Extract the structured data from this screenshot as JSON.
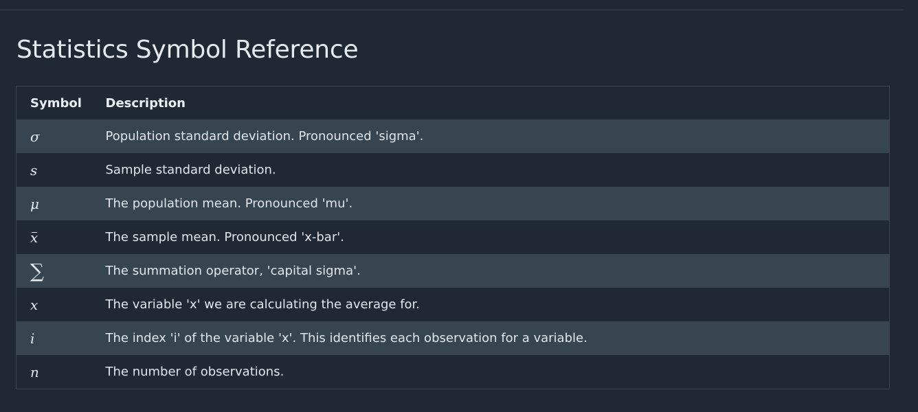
{
  "page": {
    "title": "Statistics Symbol Reference"
  },
  "table": {
    "headers": {
      "symbol": "Symbol",
      "description": "Description"
    },
    "rows": [
      {
        "symbol": "σ",
        "description": "Population standard deviation. Pronounced 'sigma'."
      },
      {
        "symbol": "s",
        "description": "Sample standard deviation."
      },
      {
        "symbol": "μ",
        "description": "The population mean. Pronounced 'mu'."
      },
      {
        "symbol": "x",
        "description": "The sample mean. Pronounced 'x-bar'."
      },
      {
        "symbol": "∑",
        "description": "The summation operator, 'capital sigma'."
      },
      {
        "symbol": "x",
        "description": "The variable 'x' we are calculating the average for."
      },
      {
        "symbol": "i",
        "description": "The index 'i' of the variable 'x'. This identifies each observation for a variable."
      },
      {
        "symbol": "n",
        "description": "The number of observations."
      }
    ]
  },
  "colors": {
    "background": "#1f2833",
    "row_stripe": "#374550",
    "border": "#3a4550",
    "text": "#e3e7ec"
  }
}
